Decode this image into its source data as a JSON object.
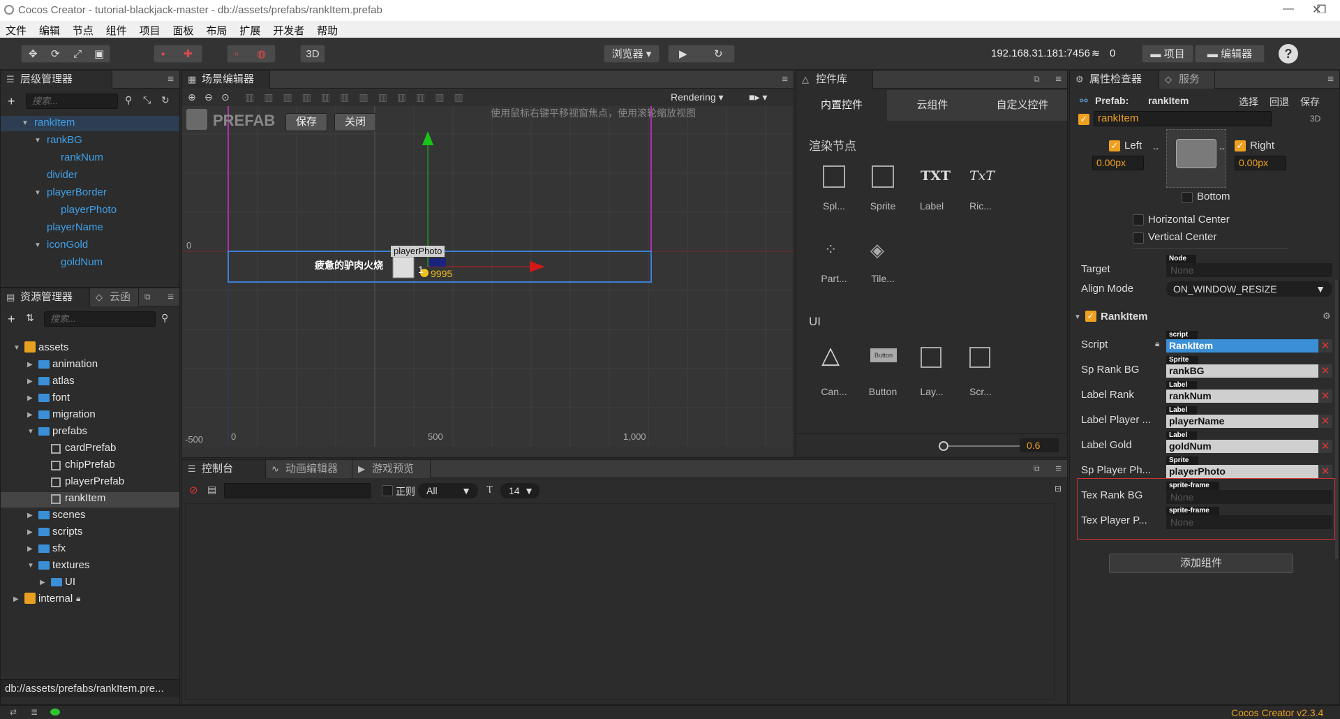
{
  "window": {
    "title": "Cocos Creator - tutorial-blackjack-master - db://assets/prefabs/rankItem.prefab",
    "min": "—",
    "max": "❐",
    "close": "✕"
  },
  "menu": [
    "文件",
    "编辑",
    "节点",
    "组件",
    "项目",
    "面板",
    "布局",
    "扩展",
    "开发者",
    "帮助"
  ],
  "toolbar": {
    "browser": "浏览器 ▾",
    "three_d": "3D",
    "ip": "192.168.31.181:7456",
    "wifi_count": "0",
    "project": "项目",
    "editor": "编辑器",
    "help": "?"
  },
  "hierarchy": {
    "tab": "层级管理器",
    "search_placeholder": "搜索...",
    "nodes": [
      "rankItem",
      "rankBG",
      "rankNum",
      "divider",
      "playerBorder",
      "playerPhoto",
      "playerName",
      "iconGold",
      "goldNum"
    ]
  },
  "assets": {
    "tab": "资源管理器",
    "tab2": "云函",
    "search_placeholder": "搜索...",
    "items": [
      "assets",
      "animation",
      "atlas",
      "font",
      "migration",
      "prefabs",
      "cardPrefab",
      "chipPrefab",
      "playerPrefab",
      "rankItem",
      "scenes",
      "scripts",
      "sfx",
      "textures",
      "UI",
      "internal"
    ],
    "path": "db://assets/prefabs/rankItem.pre..."
  },
  "scene": {
    "tab": "场景编辑器",
    "rendering": "Rendering",
    "prefab_label": "PREFAB",
    "save": "保存",
    "close": "关闭",
    "hint": "使用鼠标右键平移视窗焦点，使用滚轮缩放视图",
    "axis_zero_y": "0",
    "ticks_x": [
      "-500",
      "0",
      "500",
      "1,000"
    ],
    "item_name": "疲惫的驴肉火烧",
    "item_rank": "1",
    "photo_label": "playerPhoto",
    "gold": "9995"
  },
  "library": {
    "tab": "控件库",
    "subtabs": [
      "内置控件",
      "云组件",
      "自定义控件"
    ],
    "render_section": "渲染节点",
    "render_items": [
      "Spl...",
      "Sprite",
      "Label",
      "Ric...",
      "Part...",
      "Tile..."
    ],
    "render_glyphs": [
      "TXT",
      "TxT"
    ],
    "ui_section": "UI",
    "ui_items": [
      "Can...",
      "Button",
      "Lay...",
      "Scr..."
    ],
    "button_glyph": "Button",
    "zoom": "0.6"
  },
  "console": {
    "tabs": [
      "控制台",
      "动画编辑器",
      "游戏预览"
    ],
    "regex": "正则",
    "filter": "All",
    "fontsize": "14"
  },
  "inspector": {
    "tab": "属性检查器",
    "tab2": "服务",
    "prefab_label": "Prefab:",
    "prefab_name": "rankItem",
    "actions": [
      "选择",
      "回退",
      "保存"
    ],
    "node_name": "rankItem",
    "three_d": "3D",
    "left_label": "Left",
    "left_value": "0.00px",
    "right_label": "Right",
    "right_value": "0.00px",
    "bottom_label": "Bottom",
    "hcenter": "Horizontal Center",
    "vcenter": "Vertical Center",
    "target_label": "Target",
    "target_badge": "Node",
    "target_value": "None",
    "align_label": "Align Mode",
    "align_value": "ON_WINDOW_RESIZE",
    "component": "RankItem",
    "props": [
      {
        "label": "Script",
        "badge": "script",
        "value": "RankItem"
      },
      {
        "label": "Sp Rank BG",
        "badge": "Sprite",
        "value": "rankBG"
      },
      {
        "label": "Label Rank",
        "badge": "Label",
        "value": "rankNum"
      },
      {
        "label": "Label Player ...",
        "badge": "Label",
        "value": "playerName"
      },
      {
        "label": "Label Gold",
        "badge": "Label",
        "value": "goldNum"
      },
      {
        "label": "Sp Player Ph...",
        "badge": "Sprite",
        "value": "playerPhoto"
      },
      {
        "label": "Tex Rank BG",
        "badge": "sprite-frame",
        "value": "None"
      },
      {
        "label": "Tex Player P...",
        "badge": "sprite-frame",
        "value": "None"
      }
    ],
    "add_component": "添加组件"
  },
  "status": {
    "version": "Cocos Creator v2.3.4"
  },
  "colors": {
    "accent": "#f0a020",
    "link": "#40a0e8",
    "selected": "#2f6fae"
  }
}
